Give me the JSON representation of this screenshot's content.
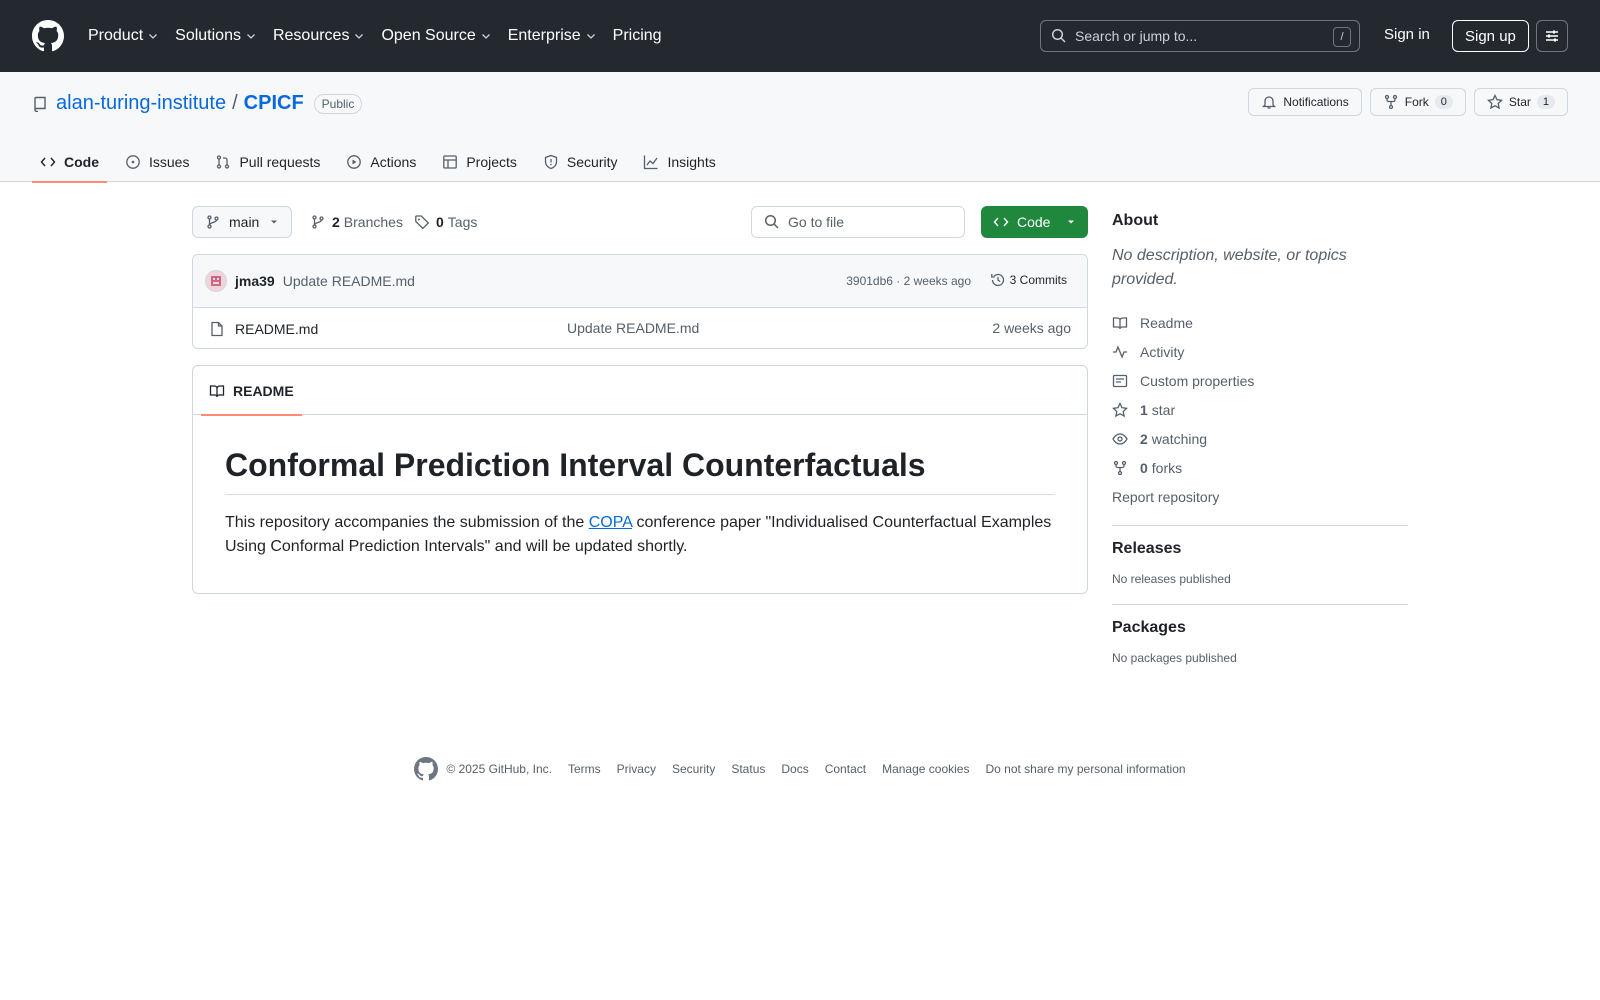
{
  "header": {
    "nav": [
      "Product",
      "Solutions",
      "Resources",
      "Open Source",
      "Enterprise",
      "Pricing"
    ],
    "search_placeholder": "Search or jump to...",
    "search_key": "/",
    "signin": "Sign in",
    "signup": "Sign up"
  },
  "repo": {
    "owner": "alan-turing-institute",
    "separator": "/",
    "name": "CPICF",
    "visibility": "Public",
    "notifications": "Notifications",
    "fork_label": "Fork",
    "fork_count": "0",
    "star_label": "Star",
    "star_count": "1",
    "tabs": [
      "Code",
      "Issues",
      "Pull requests",
      "Actions",
      "Projects",
      "Security",
      "Insights"
    ]
  },
  "file_nav": {
    "branch": "main",
    "branches_count": "2",
    "branches_label": "Branches",
    "tags_count": "0",
    "tags_label": "Tags",
    "goto_placeholder": "Go to file",
    "code_button": "Code"
  },
  "commit": {
    "author": "jma39",
    "message": "Update README.md",
    "meta": "3901db6 · 2 weeks ago",
    "commits": "3 Commits"
  },
  "files": [
    {
      "name": "README.md",
      "message": "Update README.md",
      "time": "2 weeks ago"
    }
  ],
  "readme": {
    "tab": "README",
    "title": "Conformal Prediction Interval Counterfactuals",
    "text_before": "This repository accompanies the submission of the ",
    "link": "COPA",
    "text_after": " conference paper \"Individualised Counterfactual Examples Using Conformal Prediction Intervals\" and will be updated shortly."
  },
  "sidebar": {
    "about_title": "About",
    "description": "No description, website, or topics provided.",
    "readme": "Readme",
    "activity": "Activity",
    "custom_properties": "Custom properties",
    "stars_count": "1",
    "stars_label": "star",
    "watching_count": "2",
    "watching_label": "watching",
    "forks_count": "0",
    "forks_label": "forks",
    "report": "Report repository",
    "releases_title": "Releases",
    "releases_text": "No releases published",
    "packages_title": "Packages",
    "packages_text": "No packages published"
  },
  "footer": {
    "copyright": "© 2025 GitHub, Inc.",
    "links": [
      "Terms",
      "Privacy",
      "Security",
      "Status",
      "Docs",
      "Contact",
      "Manage cookies",
      "Do not share my personal information"
    ]
  },
  "colors": {
    "header_bg": "#24292f",
    "link": "#0969da",
    "primary_button": "#1f883d",
    "tab_underline": "#fd8c73"
  }
}
